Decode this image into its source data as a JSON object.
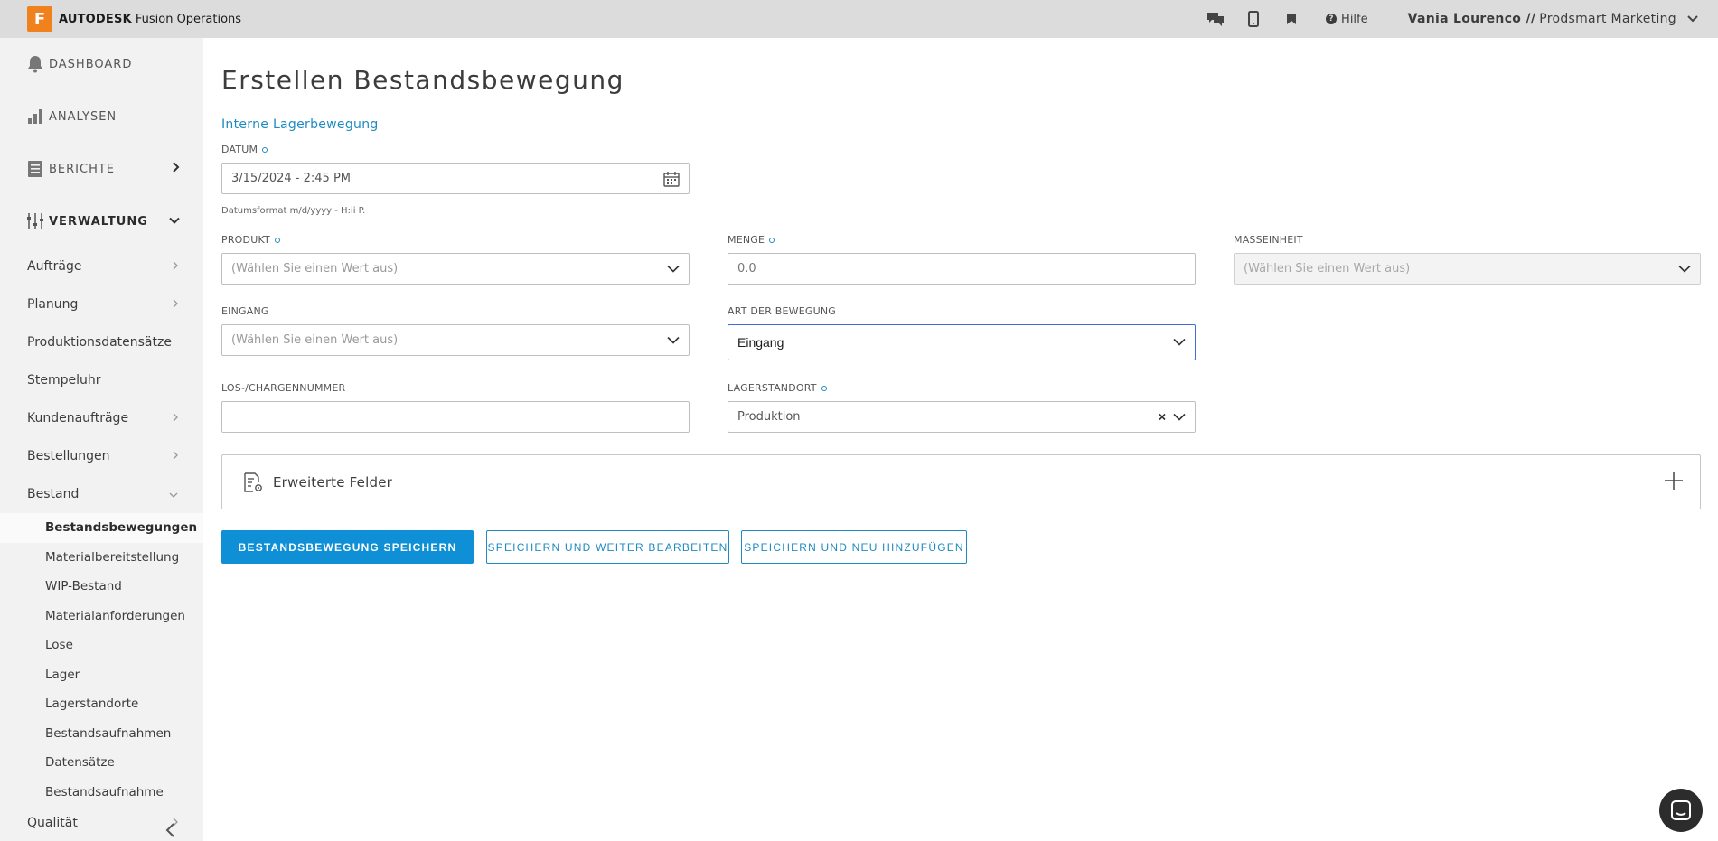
{
  "brand": {
    "logo_letter": "F",
    "name": "AUTODESK",
    "product": "Fusion Operations"
  },
  "topbar": {
    "help_label": "Hilfe",
    "user_name": "Vania Lourenco //",
    "user_org": "Prodsmart Marketing"
  },
  "sidebar": {
    "main": [
      {
        "label": "DASHBOARD",
        "icon": "bell-icon"
      },
      {
        "label": "ANALYSEN",
        "icon": "bar-chart-icon"
      },
      {
        "label": "BERICHTE",
        "icon": "report-icon"
      },
      {
        "label": "VERWALTUNG",
        "icon": "sliders-icon"
      }
    ],
    "sub": [
      {
        "label": "Aufträge"
      },
      {
        "label": "Planung"
      },
      {
        "label": "Produktionsdatensätze"
      },
      {
        "label": "Stempeluhr"
      },
      {
        "label": "Kundenaufträge"
      },
      {
        "label": "Bestellungen"
      },
      {
        "label": "Bestand"
      }
    ],
    "subsub": [
      {
        "label": "Bestandsbewegungen"
      },
      {
        "label": "Materialbereitstellung"
      },
      {
        "label": "WIP-Bestand"
      },
      {
        "label": "Materialanforderungen"
      },
      {
        "label": "Lose"
      },
      {
        "label": "Lager"
      },
      {
        "label": "Lagerstandorte"
      },
      {
        "label": "Bestandsaufnahmen"
      },
      {
        "label": "Datensätze"
      },
      {
        "label": "Bestandsaufnahme"
      }
    ],
    "bottom": {
      "label": "Qualität"
    }
  },
  "main": {
    "title": "Erstellen Bestandsbewegung",
    "subtitle": "Interne Lagerbewegung",
    "datum": {
      "label": "DATUM",
      "value": "3/15/2024 - 2:45 PM",
      "hint": "Datumsformat m/d/yyyy - H:ii P."
    },
    "produkt": {
      "label": "PRODUKT",
      "placeholder": "(Wählen Sie einen Wert aus)"
    },
    "menge": {
      "label": "MENGE",
      "value": "0.0"
    },
    "masseinheit": {
      "label": "MASSEINHEIT",
      "placeholder": "(Wählen Sie einen Wert aus)"
    },
    "eingang": {
      "label": "EINGANG",
      "placeholder": "(Wählen Sie einen Wert aus)"
    },
    "art": {
      "label": "ART DER BEWEGUNG",
      "value": "Eingang"
    },
    "los": {
      "label": "LOS-/CHARGENNUMMER",
      "value": ""
    },
    "lagerstandort": {
      "label": "LAGERSTANDORT",
      "value": "Produktion"
    },
    "extended": {
      "label": "Erweiterte Felder"
    },
    "buttons": {
      "save": "BESTANDSBEWEGUNG SPEICHERN",
      "save_continue": "SPEICHERN UND WEITER BEARBEITEN",
      "save_new": "SPEICHERN UND NEU HINZUFÜGEN"
    }
  },
  "colors": {
    "accent": "#0e8fd6",
    "link": "#1f8ac0",
    "brand": "#f0821e",
    "topbar": "#dcdcdc",
    "sidebar": "#f2f2f2"
  }
}
